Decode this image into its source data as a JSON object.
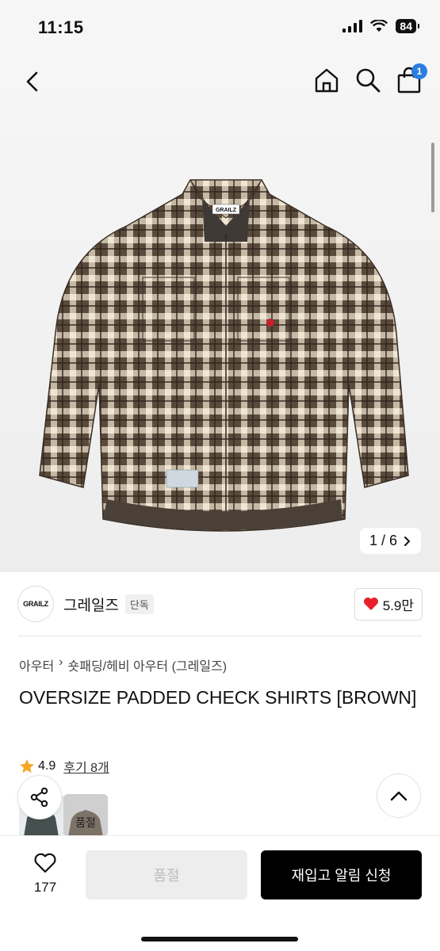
{
  "status": {
    "time": "11:15",
    "battery": "84"
  },
  "nav": {
    "cart_count": "1"
  },
  "gallery": {
    "pager": "1 / 6",
    "tag_text": "GRAILZ"
  },
  "brand": {
    "logo_text": "GRAILZ",
    "name": "그레일즈",
    "tag": "단독",
    "likes": "5.9만"
  },
  "breadcrumb": {
    "first": "아우터",
    "second": "숏패딩/헤비 아우터 (그레일즈)"
  },
  "product": {
    "title": "OVERSIZE PADDED CHECK SHIRTS [BROWN]"
  },
  "rating": {
    "score": "4.9",
    "review_label": "후기 8개"
  },
  "thumbnails": {
    "sold_out_label": "품절"
  },
  "bottom": {
    "wish_count": "177",
    "soldout_label": "품절",
    "restock_label": "재입고 알림 신청"
  },
  "colors": {
    "accent_blue": "#2a7de1",
    "heart_red": "#e8202c",
    "star_orange": "#f5a623"
  }
}
